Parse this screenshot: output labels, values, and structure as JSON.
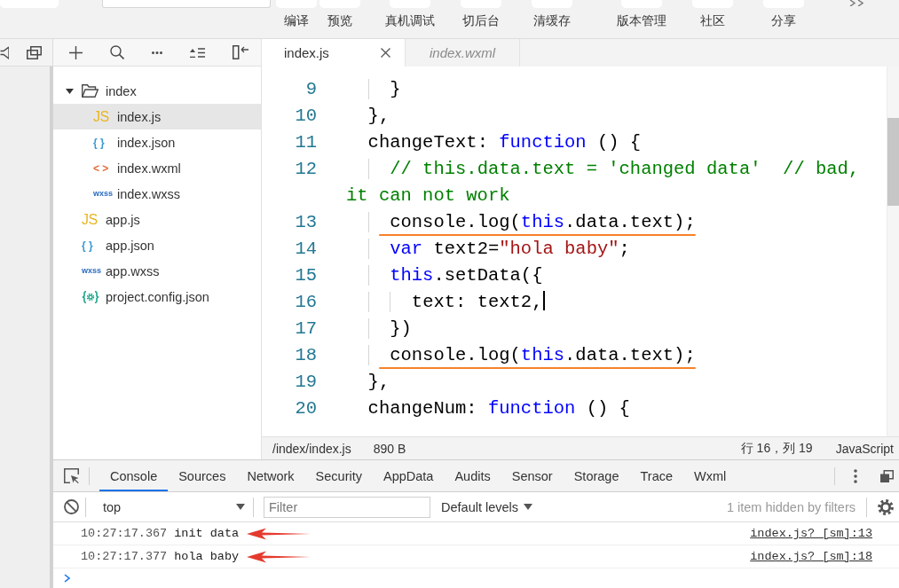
{
  "toolbar": {
    "groups": [
      {
        "buttons": [
          {
            "label": "编译"
          },
          {
            "label": "预览"
          }
        ]
      },
      {
        "buttons": [
          {
            "label": "真机调试"
          },
          {
            "label": "切后台"
          },
          {
            "label": "清缓存"
          }
        ]
      },
      {
        "buttons": [
          {
            "label": "版本管理"
          },
          {
            "label": "社区"
          },
          {
            "label": "分享"
          }
        ]
      }
    ]
  },
  "file_tree": {
    "items": [
      {
        "kind": "folder",
        "name": "index",
        "expanded": true,
        "selected": false,
        "children": [
          {
            "kind": "js",
            "icon": "JS",
            "name": "index.js",
            "selected": true
          },
          {
            "kind": "json",
            "icon": "{ }",
            "name": "index.json",
            "selected": false
          },
          {
            "kind": "wxml",
            "icon": "< >",
            "name": "index.wxml",
            "selected": false
          },
          {
            "kind": "wxss",
            "icon": "wxss",
            "name": "index.wxss",
            "selected": false
          }
        ]
      },
      {
        "kind": "js",
        "icon": "JS",
        "name": "app.js",
        "selected": false
      },
      {
        "kind": "json",
        "icon": "{ }",
        "name": "app.json",
        "selected": false
      },
      {
        "kind": "wxss",
        "icon": "wxss",
        "name": "app.wxss",
        "selected": false
      },
      {
        "kind": "config",
        "name": "project.config.json",
        "selected": false
      }
    ]
  },
  "editor": {
    "tabs": [
      {
        "label": "index.js",
        "selected": true,
        "preview": false
      },
      {
        "label": "index.wxml",
        "selected": false,
        "preview": true
      }
    ],
    "lines": [
      {
        "number": "9",
        "tokens": [
          {
            "kind": "plain",
            "text": "    }"
          }
        ],
        "cursor": false,
        "underlined": false
      },
      {
        "number": "10",
        "tokens": [
          {
            "kind": "plain",
            "text": "  },"
          }
        ],
        "cursor": false,
        "underlined": false
      },
      {
        "number": "11",
        "tokens": [
          {
            "kind": "plain",
            "text": "  changeText: "
          },
          {
            "kind": "keyword",
            "text": "function"
          },
          {
            "kind": "plain",
            "text": " () {"
          }
        ],
        "cursor": false,
        "underlined": false
      },
      {
        "number": "12",
        "tokens": [
          {
            "kind": "comment",
            "text": "    // this.data.text = 'changed data'  // bad, it can not work"
          }
        ],
        "cursor": false,
        "underlined": false
      },
      {
        "number": "13",
        "tokens": [
          {
            "kind": "plain",
            "text": "    console.log("
          },
          {
            "kind": "keyword",
            "text": "this"
          },
          {
            "kind": "plain",
            "text": ".data.text);"
          }
        ],
        "cursor": false,
        "underlined": true
      },
      {
        "number": "14",
        "tokens": [
          {
            "kind": "keyword",
            "text": "    var"
          },
          {
            "kind": "plain",
            "text": " text2="
          },
          {
            "kind": "string",
            "text": "\"hola baby\""
          },
          {
            "kind": "plain",
            "text": ";"
          }
        ],
        "cursor": false,
        "underlined": false
      },
      {
        "number": "15",
        "tokens": [
          {
            "kind": "keyword",
            "text": "    this"
          },
          {
            "kind": "plain",
            "text": ".setData({"
          }
        ],
        "cursor": false,
        "underlined": false
      },
      {
        "number": "16",
        "tokens": [
          {
            "kind": "plain",
            "text": "      text: text2,"
          }
        ],
        "cursor": true,
        "underlined": false
      },
      {
        "number": "17",
        "tokens": [
          {
            "kind": "plain",
            "text": "    })"
          }
        ],
        "cursor": false,
        "underlined": false
      },
      {
        "number": "18",
        "tokens": [
          {
            "kind": "plain",
            "text": "    console.log("
          },
          {
            "kind": "keyword",
            "text": "this"
          },
          {
            "kind": "plain",
            "text": ".data.text);"
          }
        ],
        "cursor": false,
        "underlined": true
      },
      {
        "number": "19",
        "tokens": [
          {
            "kind": "plain",
            "text": "  },"
          }
        ],
        "cursor": false,
        "underlined": false
      },
      {
        "number": "20",
        "tokens": [
          {
            "kind": "plain",
            "text": "  changeNum: "
          },
          {
            "kind": "keyword",
            "text": "function"
          },
          {
            "kind": "plain",
            "text": " () {"
          }
        ],
        "cursor": false,
        "underlined": false
      }
    ]
  },
  "status_bar": {
    "path": "/index/index.js",
    "size": "890 B",
    "position": "行 16，列 19",
    "language": "JavaScript"
  },
  "devtools": {
    "tabs": [
      {
        "label": "Console",
        "selected": true
      },
      {
        "label": "Sources",
        "selected": false
      },
      {
        "label": "Network",
        "selected": false
      },
      {
        "label": "Security",
        "selected": false
      },
      {
        "label": "AppData",
        "selected": false
      },
      {
        "label": "Audits",
        "selected": false
      },
      {
        "label": "Sensor",
        "selected": false
      },
      {
        "label": "Storage",
        "selected": false
      },
      {
        "label": "Trace",
        "selected": false
      },
      {
        "label": "Wxml",
        "selected": false
      }
    ],
    "context": "top",
    "filter": {
      "placeholder": "Filter"
    },
    "levels": "Default levels",
    "hidden_note": "1 item hidden by filters",
    "messages": [
      {
        "time": "10:27:17.367",
        "text": "init data",
        "source": "index.js? [sm]:13",
        "annotated": true
      },
      {
        "time": "10:27:17.377",
        "text": "hola baby",
        "source": "index.js? [sm]:18",
        "annotated": true
      }
    ]
  }
}
